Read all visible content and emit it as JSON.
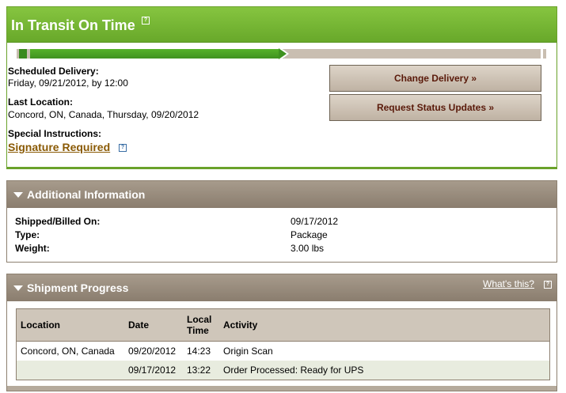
{
  "status": {
    "title": "In Transit On Time",
    "progress_fraction": 0.5,
    "scheduled_label": "Scheduled Delivery:",
    "scheduled_value": "Friday, 09/21/2012, by 12:00",
    "last_location_label": "Last Location:",
    "last_location_value": "Concord, ON, Canada, Thursday, 09/20/2012",
    "special_label": "Special Instructions:",
    "signature_link": "Signature Required",
    "change_button": "Change Delivery »",
    "request_button": "Request Status Updates »",
    "help_glyph": "?"
  },
  "additional": {
    "title": "Additional Information",
    "rows": [
      {
        "label": "Shipped/Billed On:",
        "value": "09/17/2012"
      },
      {
        "label": "Type:",
        "value": "Package"
      },
      {
        "label": "Weight:",
        "value": "3.00 lbs"
      }
    ]
  },
  "shipment": {
    "title": "Shipment Progress",
    "whats_this": "What's this?",
    "headers": [
      "Location",
      "Date",
      "Local Time",
      "Activity"
    ],
    "rows": [
      {
        "location": "Concord, ON, Canada",
        "date": "09/20/2012",
        "time": "14:23",
        "activity": "Origin Scan"
      },
      {
        "location": "",
        "date": "09/17/2012",
        "time": "13:22",
        "activity": "Order Processed: Ready for UPS"
      }
    ]
  },
  "colors": {
    "green": "#6aa22a",
    "brown": "#8a7d6e",
    "link_gold": "#8a5a05",
    "button_text": "#5a1a0a"
  }
}
